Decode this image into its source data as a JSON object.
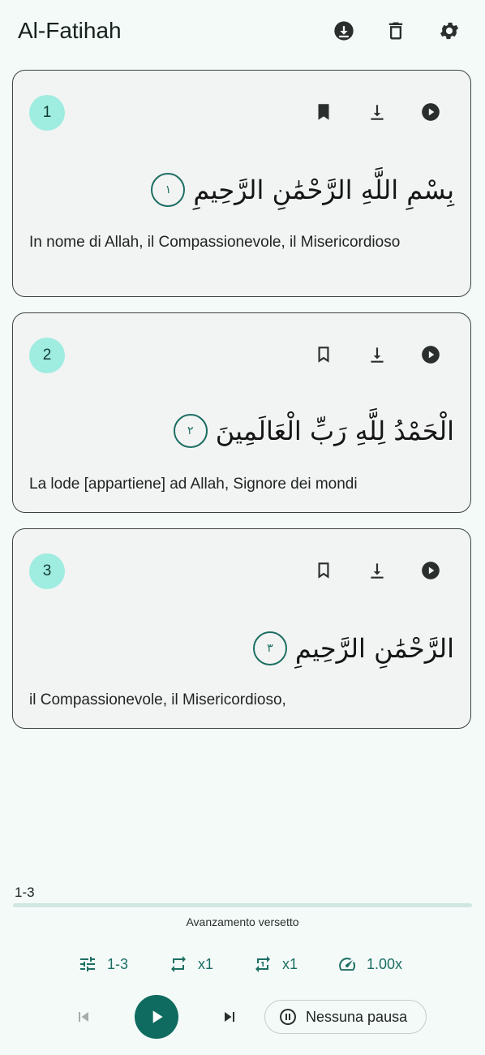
{
  "header": {
    "title": "Al-Fatihah"
  },
  "verses": [
    {
      "number": "1",
      "bookmarked": true,
      "arabic": "بِسْمِ اللَّهِ الرَّحْمَٰنِ الرَّحِيمِ",
      "verse_marker": "١",
      "translation": "In nome di Allah, il Compassionevole, il Misericordioso"
    },
    {
      "number": "2",
      "bookmarked": false,
      "arabic": "الْحَمْدُ لِلَّهِ رَبِّ الْعَالَمِينَ",
      "verse_marker": "٢",
      "translation": "La lode [appartiene] ad Allah, Signore dei mondi"
    },
    {
      "number": "3",
      "bookmarked": false,
      "arabic": "الرَّحْمَٰنِ الرَّحِيمِ",
      "verse_marker": "٣",
      "translation": "il Compassionevole, il Misericordioso,"
    }
  ],
  "player": {
    "range_label": "1-3",
    "progress": 0,
    "progress_caption": "Avanzamento versetto",
    "range_control": "1-3",
    "repeat_verse": "x1",
    "repeat_range": "x1",
    "speed": "1.00x",
    "pause_label": "Nessuna pausa"
  },
  "colors": {
    "accent": "#1d6e63",
    "badge": "#9fece0",
    "background": "#f3faf8"
  }
}
